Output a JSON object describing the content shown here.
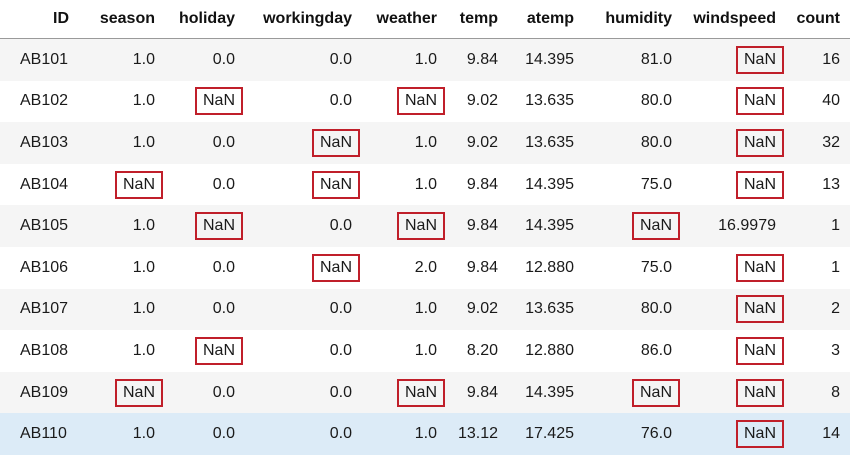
{
  "table": {
    "columns": [
      "ID",
      "season",
      "holiday",
      "workingday",
      "weather",
      "temp",
      "atemp",
      "humidity",
      "windspeed",
      "count"
    ],
    "rows": [
      [
        "AB101",
        "1.0",
        "0.0",
        "0.0",
        "1.0",
        "9.84",
        "14.395",
        "81.0",
        "NaN",
        "16"
      ],
      [
        "AB102",
        "1.0",
        "NaN",
        "0.0",
        "NaN",
        "9.02",
        "13.635",
        "80.0",
        "NaN",
        "40"
      ],
      [
        "AB103",
        "1.0",
        "0.0",
        "NaN",
        "1.0",
        "9.02",
        "13.635",
        "80.0",
        "NaN",
        "32"
      ],
      [
        "AB104",
        "NaN",
        "0.0",
        "NaN",
        "1.0",
        "9.84",
        "14.395",
        "75.0",
        "NaN",
        "13"
      ],
      [
        "AB105",
        "1.0",
        "NaN",
        "0.0",
        "NaN",
        "9.84",
        "14.395",
        "NaN",
        "16.9979",
        "1"
      ],
      [
        "AB106",
        "1.0",
        "0.0",
        "NaN",
        "2.0",
        "9.84",
        "12.880",
        "75.0",
        "NaN",
        "1"
      ],
      [
        "AB107",
        "1.0",
        "0.0",
        "0.0",
        "1.0",
        "9.02",
        "13.635",
        "80.0",
        "NaN",
        "2"
      ],
      [
        "AB108",
        "1.0",
        "NaN",
        "0.0",
        "1.0",
        "8.20",
        "12.880",
        "86.0",
        "NaN",
        "3"
      ],
      [
        "AB109",
        "NaN",
        "0.0",
        "0.0",
        "NaN",
        "9.84",
        "14.395",
        "NaN",
        "NaN",
        "8"
      ],
      [
        "AB110",
        "1.0",
        "0.0",
        "0.0",
        "1.0",
        "13.12",
        "17.425",
        "76.0",
        "NaN",
        "14"
      ]
    ],
    "highlighted_row": 9,
    "missing_marker": "NaN"
  },
  "colors": {
    "nan_border": "#c01f2a",
    "row_stripe": "#f5f5f5",
    "row_highlight": "#dcebf7",
    "header_rule": "#9a9a9a"
  }
}
